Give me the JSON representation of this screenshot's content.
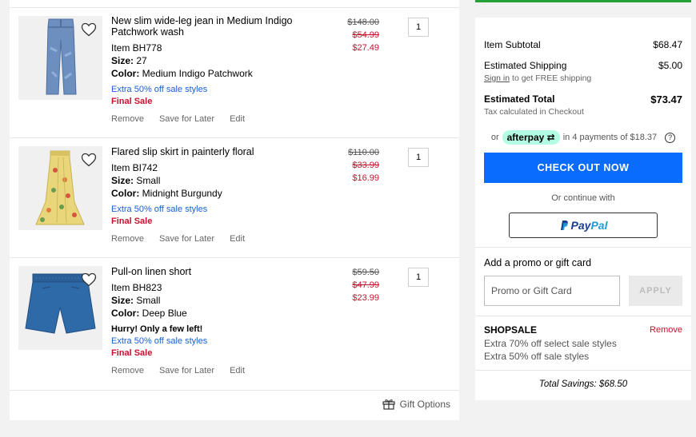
{
  "items": [
    {
      "title": "New slim wide-leg jean in Medium Indigo Patchwork wash",
      "item": "Item BH778",
      "size_label": "Size:",
      "size": "27",
      "color_label": "Color:",
      "color": "Medium Indigo Patchwork",
      "hurry": "",
      "promo": "Extra 50% off sale styles",
      "final": "Final Sale",
      "price_orig": "$148.00",
      "price_sale1": "$54.99",
      "price_sale2": "$27.49",
      "qty": "1"
    },
    {
      "title": "Flared slip skirt in painterly floral",
      "item": "Item BI742",
      "size_label": "Size:",
      "size": "Small",
      "color_label": "Color:",
      "color": "Midnight Burgundy",
      "hurry": "",
      "promo": "Extra 50% off sale styles",
      "final": "Final Sale",
      "price_orig": "$110.00",
      "price_sale1": "$33.99",
      "price_sale2": "$16.99",
      "qty": "1"
    },
    {
      "title": "Pull-on linen short",
      "item": "Item BH823",
      "size_label": "Size:",
      "size": "Small",
      "color_label": "Color:",
      "color": "Deep Blue",
      "hurry": "Hurry! Only a few left!",
      "promo": "Extra 50% off sale styles",
      "final": "Final Sale",
      "price_orig": "$59.50",
      "price_sale1": "$47.99",
      "price_sale2": "$23.99",
      "qty": "1"
    }
  ],
  "actions": {
    "remove": "Remove",
    "save": "Save for Later",
    "edit": "Edit"
  },
  "gift_options": "Gift Options",
  "summary": {
    "subtotal_label": "Item Subtotal",
    "subtotal": "$68.47",
    "shipping_label": "Estimated Shipping",
    "shipping": "$5.00",
    "signin": "Sign in",
    "signin_rest": " to get FREE shipping",
    "total_label": "Estimated Total",
    "total": "$73.47",
    "tax_note": "Tax calculated in Checkout",
    "afterpay_or": "or",
    "afterpay_brand": "afterpay",
    "afterpay_text": "in 4 payments of $18.37",
    "checkout": "CHECK OUT NOW",
    "continue_with": "Or continue with",
    "paypal_1": "Pay",
    "paypal_2": "Pal",
    "promo_title": "Add a promo or gift card",
    "promo_placeholder": "Promo or Gift Card",
    "apply": "APPLY",
    "shop_code": "SHOPSALE",
    "shop_remove": "Remove",
    "shop_line1": "Extra 70% off select sale styles",
    "shop_line2": "Extra 50% off sale styles",
    "savings": "Total Savings: $68.50"
  },
  "colors": {
    "checkout_blue": "#0a6cff",
    "sale_red": "#c8102e",
    "link_blue": "#1a5fd1",
    "afterpay_mint": "#b2fce4",
    "top_green": "#26a13a"
  }
}
